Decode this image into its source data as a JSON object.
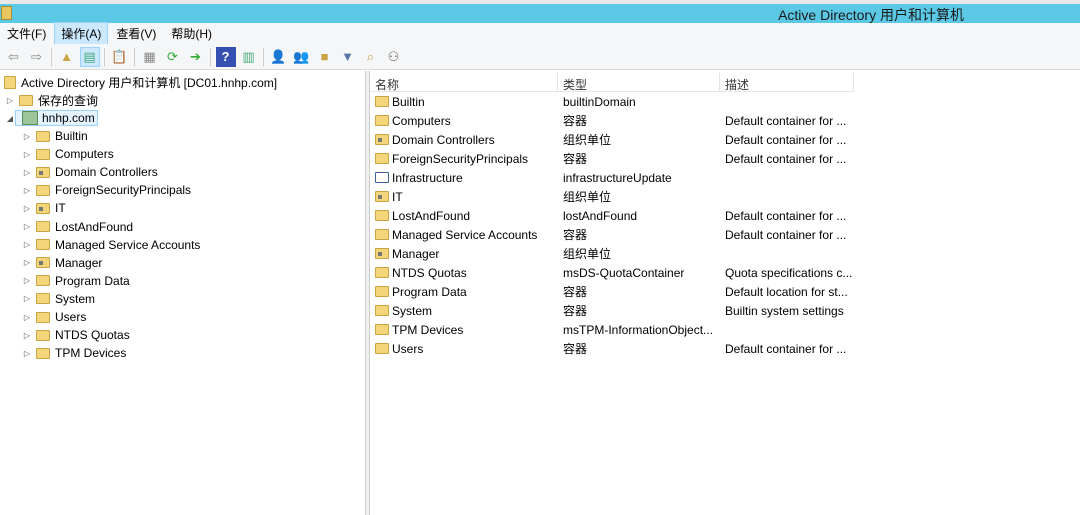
{
  "window": {
    "title": "Active Directory 用户和计算机"
  },
  "menu": [
    "文件(F)",
    "操作(A)",
    "查看(V)",
    "帮助(H)"
  ],
  "toolbar": [
    "back",
    "forward",
    "up",
    "show-hide-console-tree",
    "export-list",
    "properties",
    "refresh",
    "export",
    "help",
    "show-action-pane",
    "new-user",
    "new-group",
    "new-ou",
    "filter",
    "find",
    "add-to-group"
  ],
  "tree": {
    "root": "Active Directory 用户和计算机 [DC01.hnhp.com]",
    "saved": "保存的查询",
    "domain": "hnhp.com",
    "children": [
      {
        "label": "Builtin",
        "ou": false
      },
      {
        "label": "Computers",
        "ou": false
      },
      {
        "label": "Domain Controllers",
        "ou": true
      },
      {
        "label": "ForeignSecurityPrincipals",
        "ou": false
      },
      {
        "label": "IT",
        "ou": true
      },
      {
        "label": "LostAndFound",
        "ou": false
      },
      {
        "label": "Managed Service Accounts",
        "ou": false
      },
      {
        "label": "Manager",
        "ou": true
      },
      {
        "label": "Program Data",
        "ou": false
      },
      {
        "label": "System",
        "ou": false
      },
      {
        "label": "Users",
        "ou": false
      },
      {
        "label": "NTDS Quotas",
        "ou": false
      },
      {
        "label": "TPM Devices",
        "ou": false
      }
    ]
  },
  "list": {
    "columns": [
      "名称",
      "类型",
      "描述"
    ],
    "rows": [
      {
        "name": "Builtin",
        "type": "builtinDomain",
        "desc": "",
        "icon": "folder"
      },
      {
        "name": "Computers",
        "type": "容器",
        "desc": "Default container for ...",
        "icon": "folder"
      },
      {
        "name": "Domain Controllers",
        "type": "组织单位",
        "desc": "Default container for ...",
        "icon": "ou"
      },
      {
        "name": "ForeignSecurityPrincipals",
        "type": "容器",
        "desc": "Default container for ...",
        "icon": "folder"
      },
      {
        "name": "Infrastructure",
        "type": "infrastructureUpdate",
        "desc": "",
        "icon": "infra"
      },
      {
        "name": "IT",
        "type": "组织单位",
        "desc": "",
        "icon": "ou"
      },
      {
        "name": "LostAndFound",
        "type": "lostAndFound",
        "desc": "Default container for ...",
        "icon": "folder"
      },
      {
        "name": "Managed Service Accounts",
        "type": "容器",
        "desc": "Default container for ...",
        "icon": "folder"
      },
      {
        "name": "Manager",
        "type": "组织单位",
        "desc": "",
        "icon": "ou"
      },
      {
        "name": "NTDS Quotas",
        "type": "msDS-QuotaContainer",
        "desc": "Quota specifications c...",
        "icon": "folder"
      },
      {
        "name": "Program Data",
        "type": "容器",
        "desc": "Default location for st...",
        "icon": "folder"
      },
      {
        "name": "System",
        "type": "容器",
        "desc": "Builtin system settings",
        "icon": "folder"
      },
      {
        "name": "TPM Devices",
        "type": "msTPM-InformationObject...",
        "desc": "",
        "icon": "folder"
      },
      {
        "name": "Users",
        "type": "容器",
        "desc": "Default container for ...",
        "icon": "folder"
      }
    ]
  }
}
